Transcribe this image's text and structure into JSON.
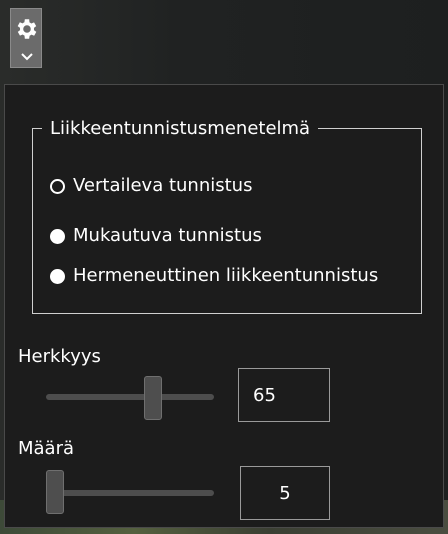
{
  "settings_button": {
    "icon": "gear-icon",
    "dropdown_icon": "chevron-down-icon"
  },
  "detection_method": {
    "legend": "Liikkeentunnistusmenetelmä",
    "options": [
      {
        "label": "Vertaileva tunnistus",
        "selected": true
      },
      {
        "label": "Mukautuva tunnistus",
        "selected": false
      },
      {
        "label": "Hermeneuttinen liikkeentunnistus",
        "selected": false
      }
    ]
  },
  "sensitivity": {
    "label": "Herkkyys",
    "value": "65",
    "level": 0.65
  },
  "amount": {
    "label": "Määrä",
    "value": "5",
    "level": 0.0
  }
}
